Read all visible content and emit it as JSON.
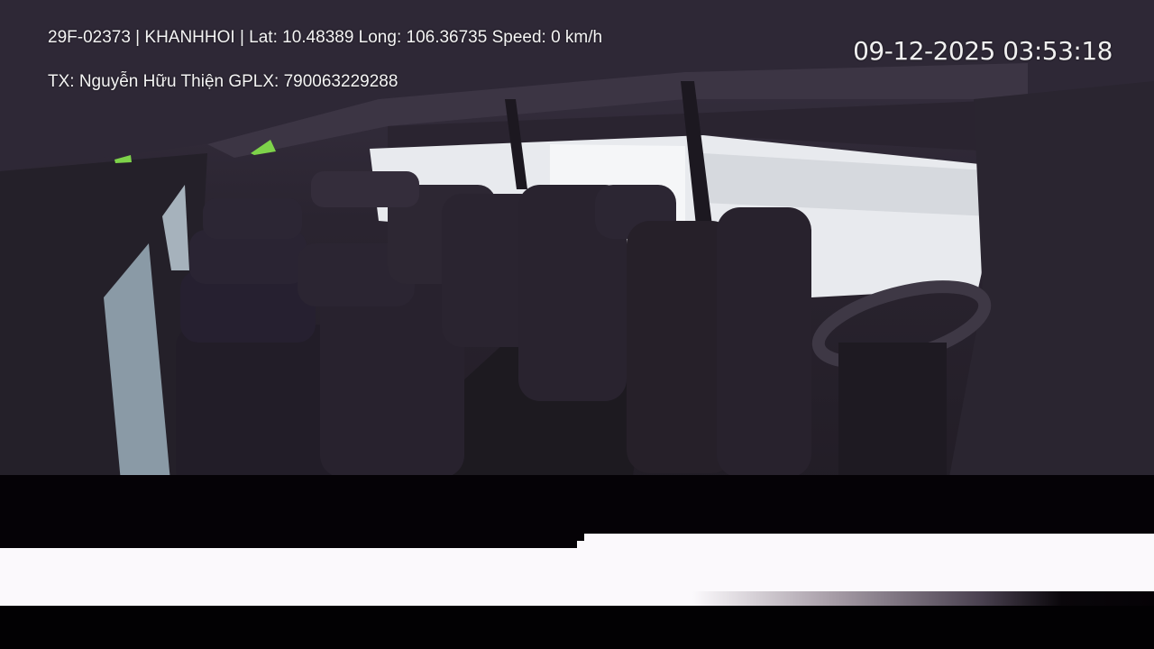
{
  "overlay": {
    "info_line": "29F-02373 | KHANHHOI | Lat: 10.48389 Long: 106.36735 Speed: 0 km/h",
    "driver_line": "TX: Nguyễn Hữu Thiện GPLX: 790063229288",
    "timestamp": "09-12-2025 03:53:18"
  },
  "colors": {
    "osd_text": "#f4f4f4",
    "glitch_black": "#050206",
    "glitch_white": "#fbf9fc"
  }
}
